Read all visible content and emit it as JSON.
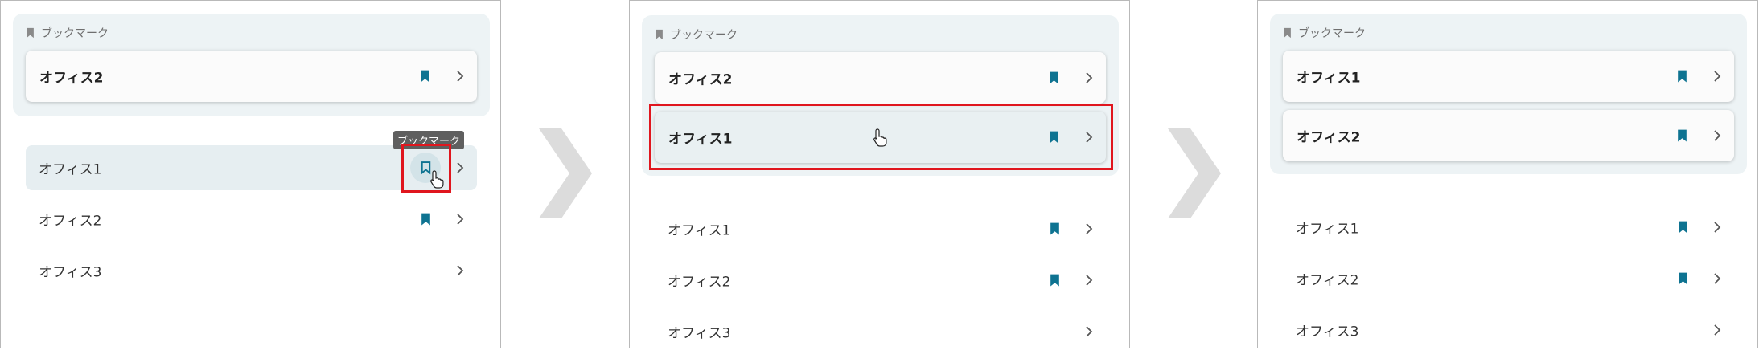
{
  "colors": {
    "bookmark": "#0e7391",
    "highlight_border": "#e0161e",
    "section_bg": "#edf3f5",
    "arrow": "#dcdcdc"
  },
  "bookmark_header": "ブックマーク",
  "tooltip": "ブックマーク",
  "step1": {
    "bookmarks": [
      {
        "label": "オフィス2",
        "bookmarked": true
      }
    ],
    "list": [
      {
        "label": "オフィス1",
        "bookmarked": false,
        "hovered": true
      },
      {
        "label": "オフィス2",
        "bookmarked": true
      },
      {
        "label": "オフィス3",
        "bookmarked": false
      }
    ]
  },
  "step2": {
    "bookmarks": [
      {
        "label": "オフィス2",
        "bookmarked": true
      },
      {
        "label": "オフィス1",
        "bookmarked": true,
        "highlighted": true
      }
    ],
    "list": [
      {
        "label": "オフィス1",
        "bookmarked": true
      },
      {
        "label": "オフィス2",
        "bookmarked": true
      },
      {
        "label": "オフィス3",
        "bookmarked": false
      }
    ]
  },
  "step3": {
    "bookmarks": [
      {
        "label": "オフィス1",
        "bookmarked": true
      },
      {
        "label": "オフィス2",
        "bookmarked": true
      }
    ],
    "list": [
      {
        "label": "オフィス1",
        "bookmarked": true
      },
      {
        "label": "オフィス2",
        "bookmarked": true
      },
      {
        "label": "オフィス3",
        "bookmarked": false
      }
    ]
  },
  "icons": [
    "bookmark-icon",
    "bookmark-outline-icon",
    "chevron-right-icon",
    "hand-pointer-icon",
    "step-arrow-icon"
  ]
}
